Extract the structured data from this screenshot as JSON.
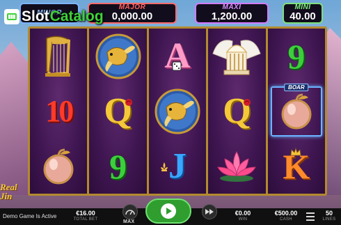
{
  "branding": {
    "name_part1": "Slot",
    "name_part2": "Catalog"
  },
  "jackpots": {
    "minor": {
      "label": "MINOR",
      "amount": ""
    },
    "major": {
      "label": "MAJOR",
      "amount": "0,000.00"
    },
    "maxi": {
      "label": "MAXI",
      "amount": "1,200.00"
    },
    "mini": {
      "label": "MINI",
      "amount": "40.00"
    }
  },
  "reels": [
    [
      "harp",
      "10",
      "peach"
    ],
    [
      "goldfish",
      "Q",
      "9"
    ],
    [
      "A",
      "goldfish",
      "J"
    ],
    [
      "temple",
      "Q",
      "lotus"
    ],
    [
      "9",
      "peach",
      "K"
    ]
  ],
  "highlight": {
    "tag": "BOAR"
  },
  "game_logo": {
    "line1": "Real",
    "line2": "Jin"
  },
  "bottom_bar": {
    "demo_text": "Demo Game Is Active",
    "total_bet": {
      "value": "€16.00",
      "label": "TOTAL BET"
    },
    "max_label": "MAX",
    "win": {
      "value": "€0.00",
      "label": "WIN"
    },
    "cash": {
      "value": "€500.00",
      "label": "CASH"
    },
    "lines": {
      "value": "50",
      "label": "LINES"
    }
  },
  "colors": {
    "reel_frame": "#b38a2e",
    "minor": "#8fc2ff",
    "major": "#ff6060",
    "maxi": "#d890ff",
    "mini": "#7ff07f",
    "spin": "#2f9e2f"
  }
}
